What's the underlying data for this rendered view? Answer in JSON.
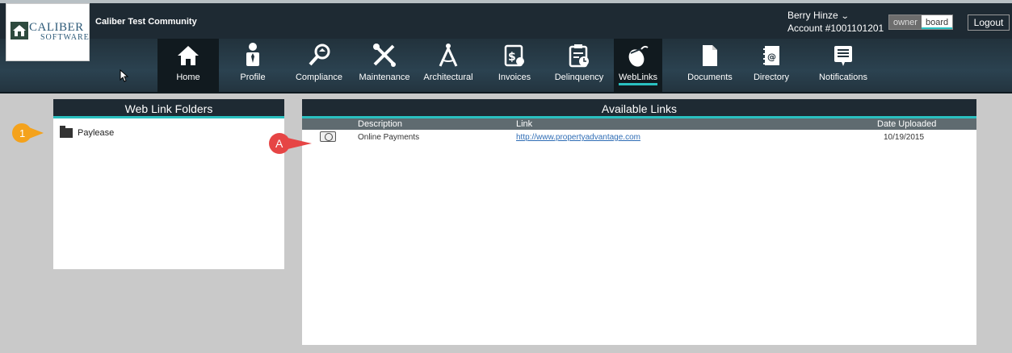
{
  "header": {
    "community": "Caliber Test Community",
    "user_name": "Berry Hinze",
    "account": "Account #1001101201",
    "role_owner": "owner",
    "role_board": "board",
    "logout": "Logout"
  },
  "logo": {
    "brand": "CALIBER",
    "sub": "SOFTWARE"
  },
  "nav": {
    "home": "Home",
    "profile": "Profile",
    "compliance": "Compliance",
    "maintenance": "Maintenance",
    "architectural": "Architectural",
    "invoices": "Invoices",
    "delinquency": "Delinquency",
    "weblinks": "WebLinks",
    "documents": "Documents",
    "directory": "Directory",
    "notifications": "Notifications"
  },
  "folders_panel": {
    "title": "Web Link Folders",
    "items": [
      "Paylease"
    ]
  },
  "links_panel": {
    "title": "Available Links",
    "columns": [
      "Description",
      "Link",
      "Date Uploaded"
    ],
    "rows": [
      {
        "description": "Online Payments",
        "link": "http://www.propertyadvantage.com",
        "date": "10/19/2015"
      }
    ]
  },
  "callouts": {
    "one": "1",
    "a": "A"
  },
  "colors": {
    "accent": "#2ac0c0",
    "header_bg": "#1e2a33",
    "callout_orange": "#f4a21c",
    "callout_red": "#e64545"
  }
}
